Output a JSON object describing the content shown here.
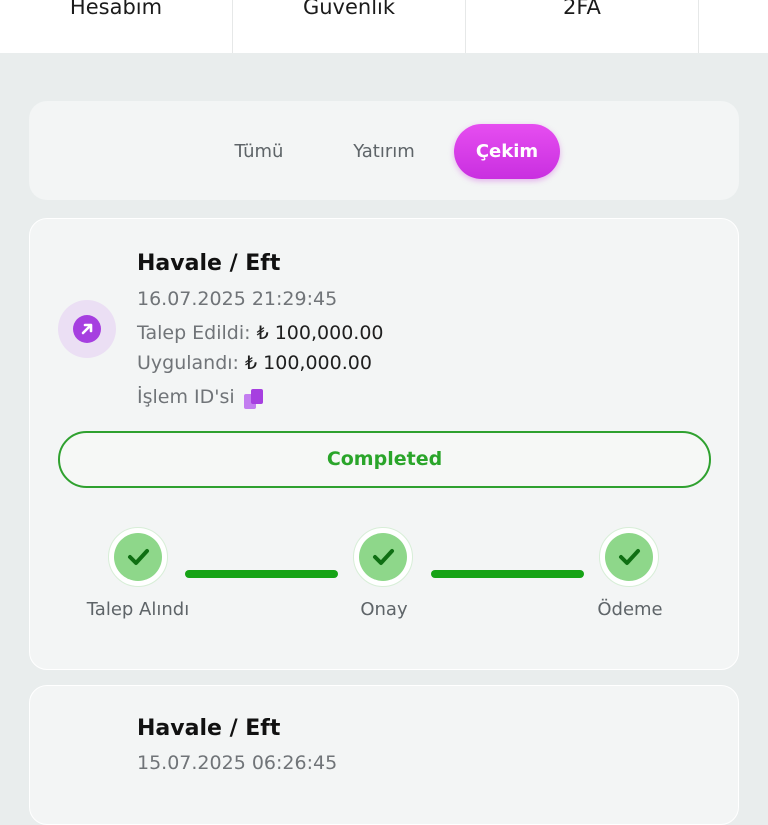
{
  "topnav": {
    "items": [
      "Hesabım",
      "Güvenlik",
      "2FA"
    ]
  },
  "filter": {
    "tabs": [
      {
        "label": "Tümü",
        "active": false
      },
      {
        "label": "Yatırım",
        "active": false
      },
      {
        "label": "Çekim",
        "active": true
      }
    ]
  },
  "transactions": [
    {
      "method": "Havale / Eft",
      "datetime": "16.07.2025 21:29:45",
      "requested_label": "Talep Edildi:",
      "requested_amount": "₺ 100,000.00",
      "applied_label": "Uygulandı:",
      "applied_amount": "₺ 100,000.00",
      "txid_label": "İşlem ID'si",
      "status": "Completed",
      "steps": [
        "Talep Alındı",
        "Onay",
        "Ödeme"
      ]
    },
    {
      "method": "Havale / Eft",
      "datetime": "15.07.2025 06:26:45"
    }
  ],
  "icons": {
    "direction": "arrow-up-right-icon",
    "copy": "copy-icon",
    "step": "check-icon"
  },
  "colors": {
    "accent": "#d83ee8",
    "success": "#2aa52a",
    "step_fill": "#8ed78a",
    "icon_bg": "#a63fe0"
  }
}
